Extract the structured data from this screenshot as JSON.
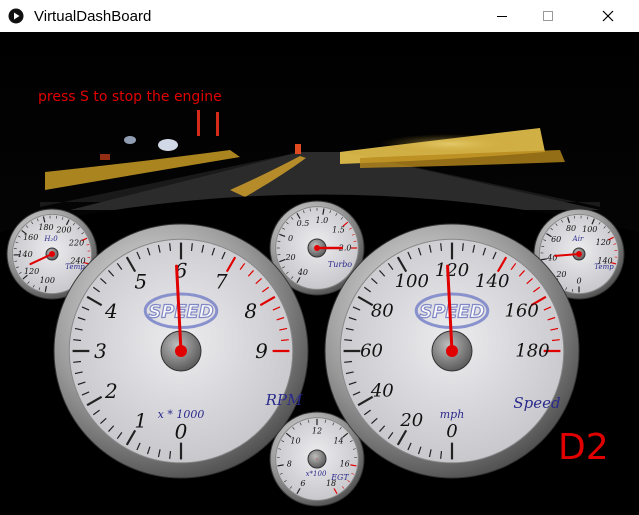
{
  "window": {
    "title": "VirtualDashBoard",
    "app_icon": "play-icon",
    "controls": {
      "minimize": "minimize-icon",
      "maximize": "maximize-icon",
      "close": "close-icon"
    }
  },
  "hint_text": "press S to stop the engine",
  "gear": "D2",
  "colors": {
    "accent_red": "#e00000",
    "needle": "#e00000",
    "gauge_text": "#2a2a8c",
    "dial_face": "#d9d9dd"
  },
  "gauges": {
    "rpm": {
      "ticks": [
        "0",
        "1",
        "2",
        "3",
        "4",
        "5",
        "6",
        "7",
        "8",
        "9"
      ],
      "unit": "x * 1000",
      "label": "RPM",
      "logo": "SPEED",
      "value": 5.9
    },
    "speed": {
      "ticks": [
        "0",
        "20",
        "40",
        "60",
        "80",
        "100",
        "120",
        "140",
        "160",
        "180"
      ],
      "unit": "mph",
      "label": "Speed",
      "logo": "SPEED",
      "value": 118
    },
    "water": {
      "ticks": [
        "100",
        "120",
        "140",
        "160",
        "180",
        "200",
        "220",
        "240"
      ],
      "label": "H₂0",
      "unit": "Temp",
      "value": 128
    },
    "turbo": {
      "ticks": [
        "40",
        "20",
        "0",
        "0.5",
        "1.0",
        "1.5",
        "2.0"
      ],
      "label": "Turbo",
      "value": 2.0
    },
    "air": {
      "ticks": [
        "0",
        "20",
        "40",
        "60",
        "80",
        "100",
        "120",
        "140"
      ],
      "label": "Air",
      "unit": "Temp",
      "value": 42
    },
    "egt": {
      "ticks": [
        "6",
        "8",
        "10",
        "12",
        "14",
        "16",
        "18"
      ],
      "unit": "x*100",
      "label": "EGT",
      "value": 10
    }
  }
}
